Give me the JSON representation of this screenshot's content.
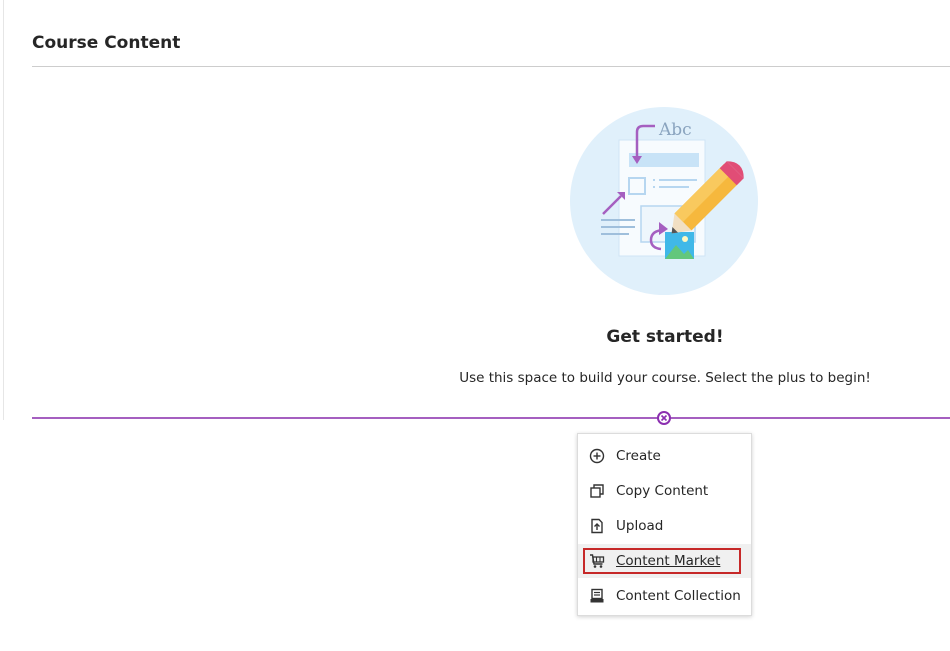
{
  "header": {
    "title": "Course Content"
  },
  "empty_state": {
    "illustration": "document-edit-illustration",
    "heading": "Get started!",
    "message": "Use this space to build your course. Select the plus to begin!",
    "illustration_text": "Abc"
  },
  "add_menu": {
    "close_icon": "close-circle-icon",
    "items": [
      {
        "label": "Create",
        "icon": "plus-circle-icon"
      },
      {
        "label": "Copy Content",
        "icon": "copy-icon"
      },
      {
        "label": "Upload",
        "icon": "upload-file-icon"
      },
      {
        "label": "Content Market",
        "icon": "cart-icon",
        "highlighted": true
      },
      {
        "label": "Content Collection",
        "icon": "collection-icon"
      }
    ]
  },
  "colors": {
    "accent_line": "#a55fc0",
    "highlight_border": "#c62828",
    "illustration_bg": "#e0f0fb"
  }
}
